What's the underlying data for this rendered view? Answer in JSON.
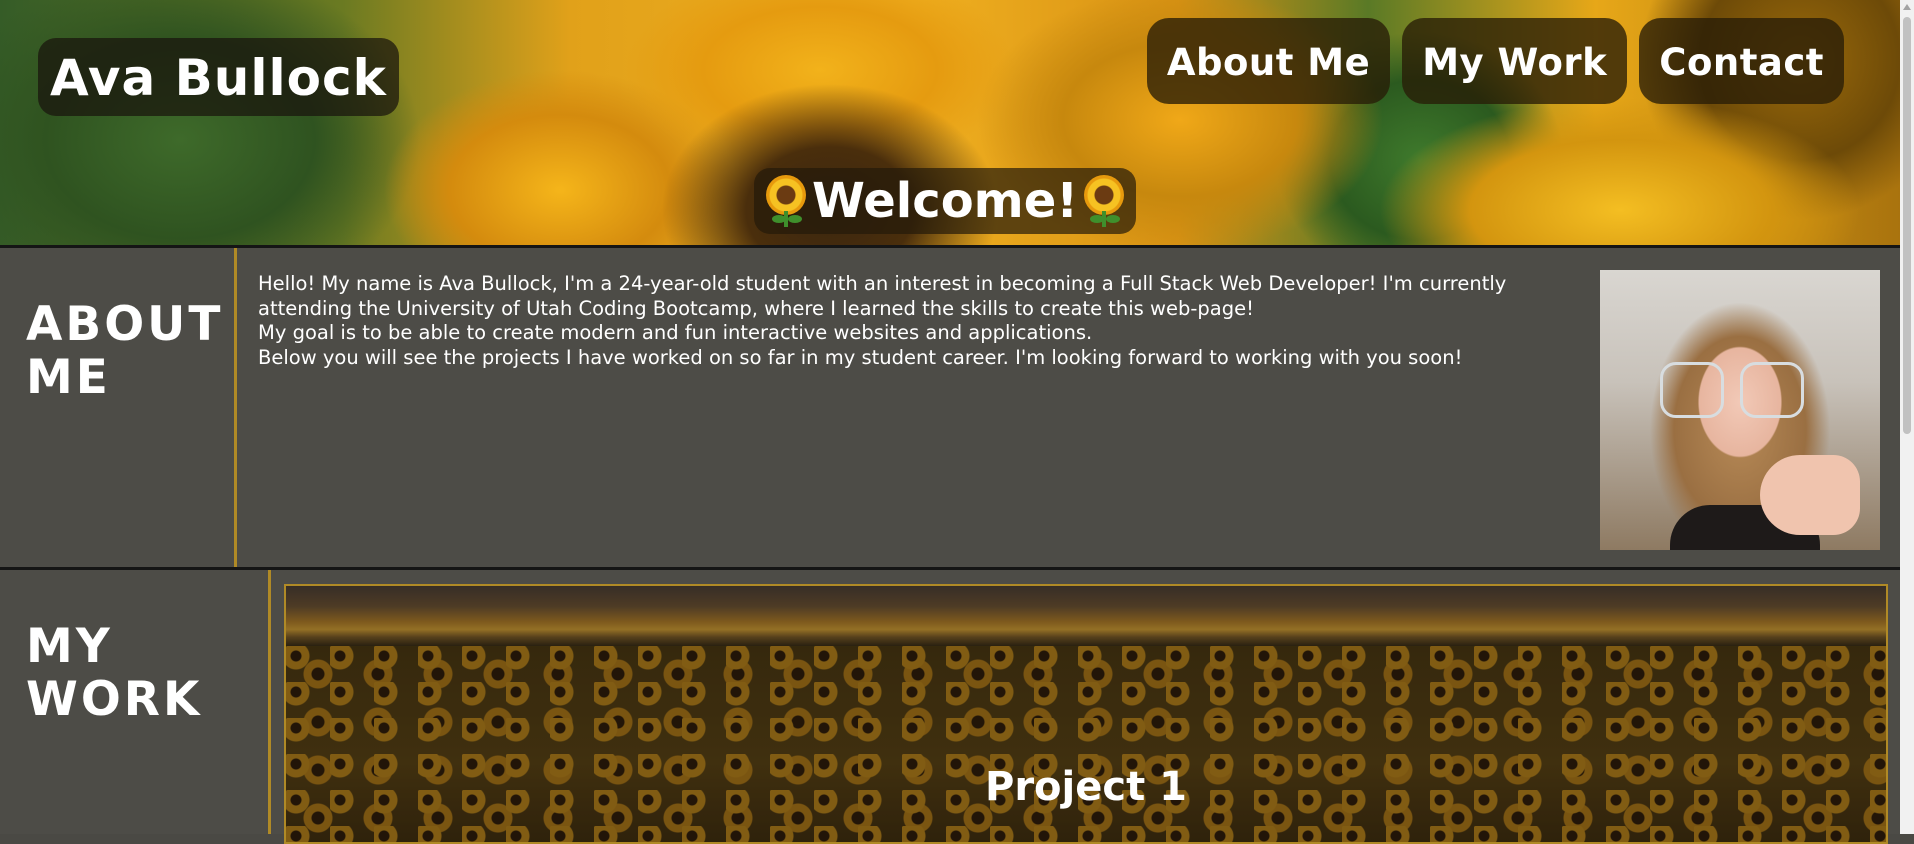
{
  "header": {
    "brand": "Ava Bullock",
    "nav": [
      {
        "label": "About Me"
      },
      {
        "label": "My Work"
      },
      {
        "label": "Contact"
      }
    ],
    "welcome": "Welcome!",
    "welcome_icon": "sunflower-icon"
  },
  "about": {
    "title_line1": "ABOUT",
    "title_line2": "ME",
    "paragraphs": [
      "Hello! My name is Ava Bullock, I'm a 24-year-old student with an interest in becoming a Full Stack Web Developer! I'm currently attending the University of Utah Coding Bootcamp, where I learned the skills to create this web-page!",
      "My goal is to be able to create modern and fun interactive websites and applications.",
      "Below you will see the projects I have worked on so far in my student career. I'm looking forward to working with you soon!"
    ]
  },
  "work": {
    "title_line1": "MY",
    "title_line2": "WORK",
    "projects": [
      {
        "title": "Project 1"
      }
    ]
  },
  "colors": {
    "section_bg": "#4d4c47",
    "accent_rule": "#b08a26",
    "divider": "#151515"
  }
}
